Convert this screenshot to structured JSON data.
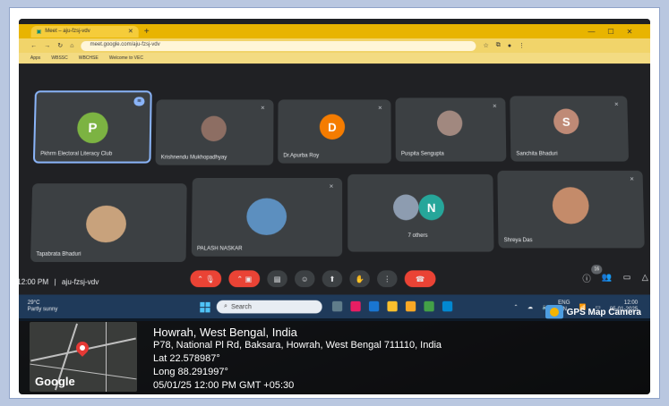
{
  "browser": {
    "tab_title": "Meet – aju-fzsj-vdv",
    "url": "meet.google.com/aju-fzsj-vdv",
    "bookmarks": [
      "Apps",
      "WBSSC",
      "WBCHSE",
      "Welcome to VEC"
    ]
  },
  "meet": {
    "meeting_code": "aju-fzsj-vdv",
    "time": "12:00 PM",
    "separator": "|",
    "others_count_badge": "16",
    "participants": [
      {
        "name": "Pkhrm Electoral Literacy Club",
        "initial": "P",
        "color": "#7cb342",
        "active": true
      },
      {
        "name": "Krishnendu Mukhopadhyay",
        "initial": "",
        "color": "#8d6e63"
      },
      {
        "name": "Dr.Apurba Roy",
        "initial": "D",
        "color": "#f57c00"
      },
      {
        "name": "Puspita Sengupta",
        "initial": "",
        "color": "#a1887f"
      },
      {
        "name": "Sanchita Bhaduri",
        "initial": "S",
        "color": "#bf8a76"
      },
      {
        "name": "Tapabrata Bhaduri",
        "initial": "",
        "color": "#c8a27c"
      },
      {
        "name": "PALASH NASKAR",
        "initial": "",
        "color": "#5c8fbf"
      },
      {
        "name": "7 others",
        "initial": "N",
        "color": "#26a69a"
      },
      {
        "name": "Shreya Das",
        "initial": "",
        "color": "#c48b6a"
      }
    ]
  },
  "taskbar": {
    "weather_temp": "29°C",
    "weather_desc": "Partly sunny",
    "search_placeholder": "Search",
    "lang": "ENG",
    "region": "IN",
    "clock_time": "12:00",
    "clock_date": "05-01-2025"
  },
  "gps": {
    "app_name": "GPS Map Camera",
    "city": "Howrah, West Bengal, India",
    "address": "P78, National Pl Rd, Baksara, Howrah, West Bengal 711110, India",
    "lat": "Lat 22.578987°",
    "long": "Long 88.291997°",
    "datetime": "05/01/25 12:00 PM GMT +05:30",
    "map_brand": "Google"
  }
}
